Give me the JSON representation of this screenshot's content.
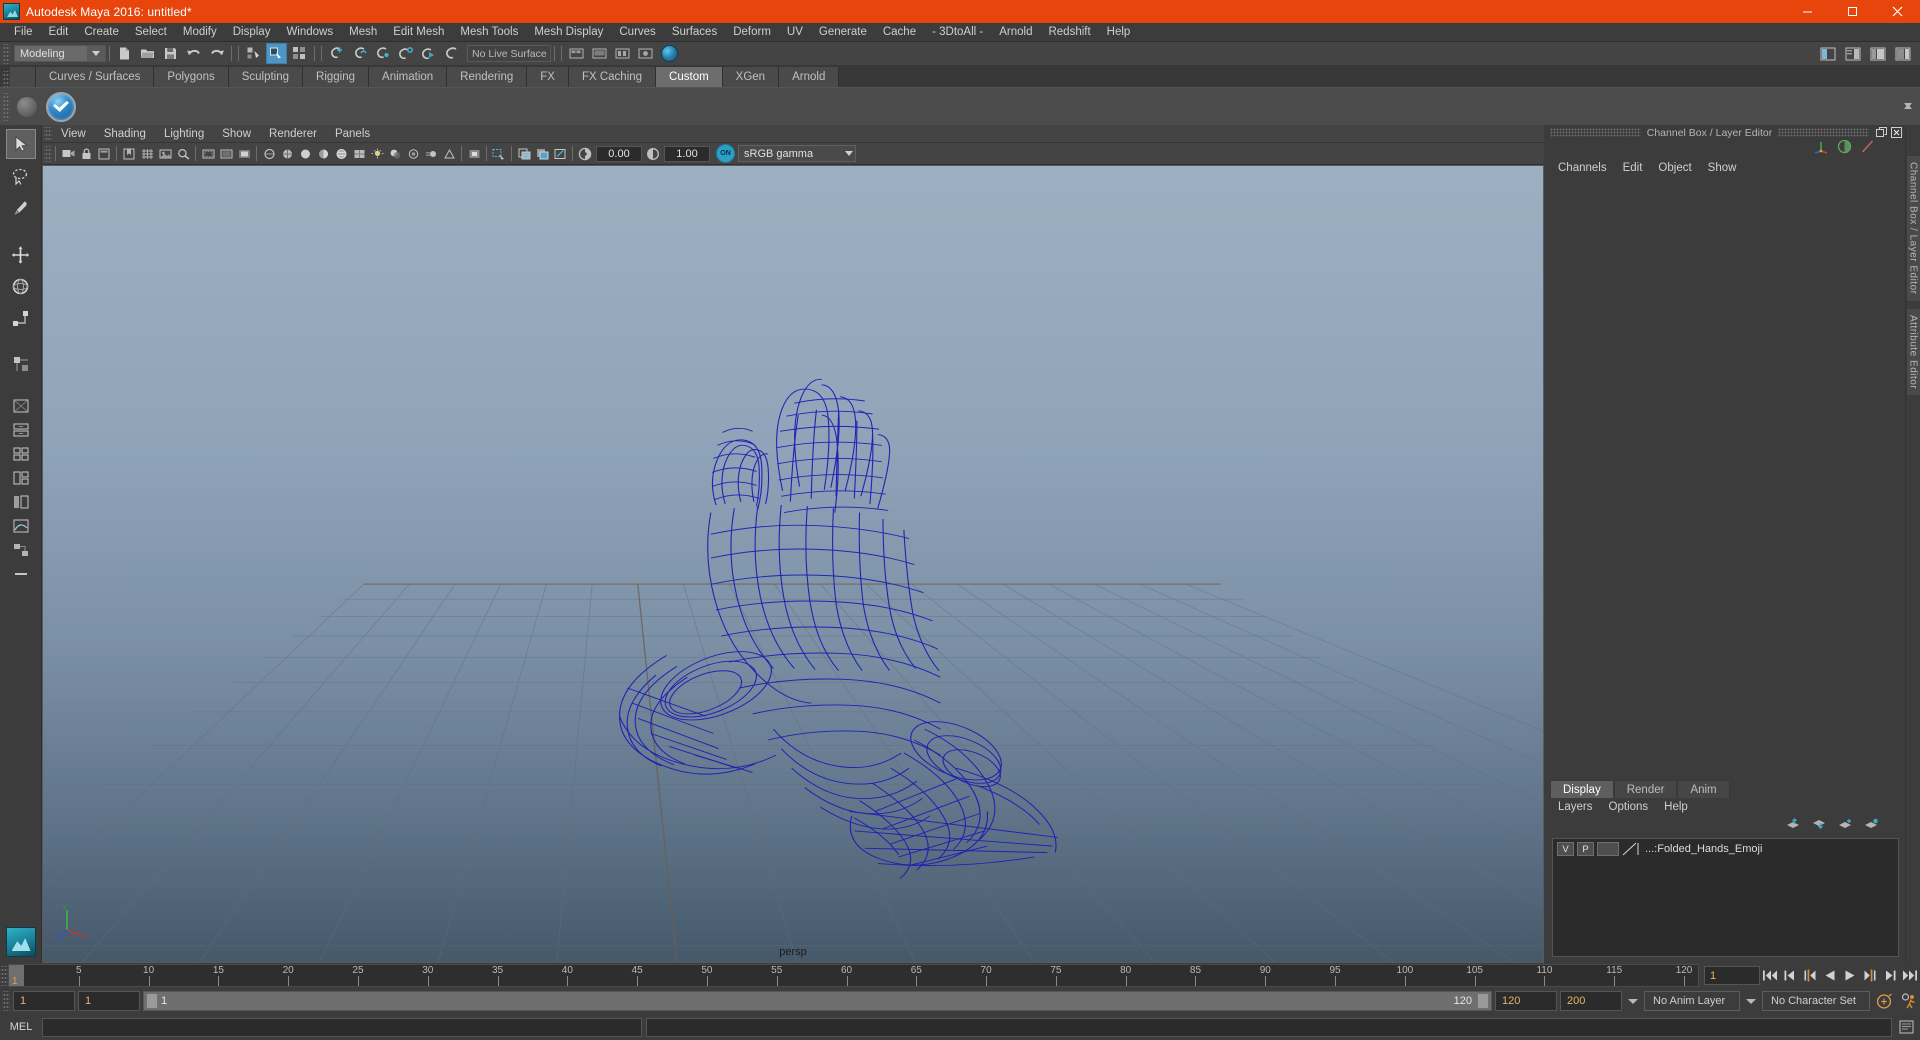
{
  "window": {
    "title": "Autodesk Maya 2016: untitled*",
    "logo_icon": "maya-logo-icon",
    "minimize_icon": "minimize-icon",
    "maximize_icon": "maximize-icon",
    "close_icon": "close-icon",
    "titlebar_color": "#e8450c"
  },
  "main_menu": [
    "File",
    "Edit",
    "Create",
    "Select",
    "Modify",
    "Display",
    "Windows",
    "Mesh",
    "Edit Mesh",
    "Mesh Tools",
    "Mesh Display",
    "Curves",
    "Surfaces",
    "Deform",
    "UV",
    "Generate",
    "Cache",
    "- 3DtoAll -",
    "Arnold",
    "Redshift",
    "Help"
  ],
  "status_bar": {
    "menu_set": "Modeling",
    "menu_set_arrow_icon": "chevron-down-icon",
    "new_scene_icon": "new-scene-icon",
    "open_scene_icon": "open-scene-icon",
    "save_scene_icon": "save-scene-icon",
    "undo_icon": "undo-icon",
    "redo_icon": "redo-icon",
    "select_hierarchy_icon": "select-by-hierarchy-icon",
    "select_object_icon": "select-by-object-type-icon",
    "select_component_icon": "select-by-component-type-icon",
    "snap_grid_icon": "snap-to-grid-icon",
    "snap_curve_icon": "snap-to-curve-icon",
    "snap_point_icon": "snap-to-point-icon",
    "snap_projected_icon": "snap-to-projected-center-icon",
    "snap_view_plane_icon": "snap-to-view-plane-icon",
    "make_live_icon": "make-live-icon",
    "live_surface_label": "No Live Surface",
    "render_sphere_icon": "render-globe-icon",
    "right_icons": [
      "show-hide-editor-icon",
      "attribute-editor-icon",
      "tool-settings-icon",
      "channel-box-icon"
    ]
  },
  "shelf": {
    "tabs": [
      "Curves / Surfaces",
      "Polygons",
      "Sculpting",
      "Rigging",
      "Animation",
      "Rendering",
      "FX",
      "FX Caching",
      "Custom",
      "XGen",
      "Arnold"
    ],
    "selected_tab": "Custom",
    "items": [
      {
        "icon": "blue-check-shelf-icon",
        "label": ""
      }
    ],
    "scroll_up_icon": "scroll-up-icon",
    "scroll_down_icon": "scroll-down-icon"
  },
  "toolbox": {
    "tools": [
      {
        "name": "select-tool",
        "icon": "arrow-cursor-icon",
        "selected": true
      },
      {
        "name": "lasso-tool",
        "icon": "lasso-select-icon",
        "selected": false
      },
      {
        "name": "paint-select-tool",
        "icon": "paint-brush-icon",
        "selected": false
      },
      {
        "name": "move-tool",
        "icon": "move-arrows-icon",
        "selected": false
      },
      {
        "name": "rotate-tool",
        "icon": "rotate-circle-icon",
        "selected": false
      },
      {
        "name": "scale-tool",
        "icon": "scale-box-icon",
        "selected": false
      },
      {
        "name": "last-tool",
        "icon": "last-used-tool-icon",
        "selected": false
      }
    ],
    "layout_buttons": [
      {
        "name": "layout-single",
        "icon": "single-pane-icon"
      },
      {
        "name": "layout-two-stacked",
        "icon": "two-pane-stacked-icon"
      },
      {
        "name": "layout-four",
        "icon": "four-pane-icon"
      },
      {
        "name": "layout-three-left",
        "icon": "three-pane-left-icon"
      },
      {
        "name": "layout-persp-outliner",
        "icon": "persp-outliner-icon"
      },
      {
        "name": "layout-persp-graph",
        "icon": "persp-graph-editor-icon"
      },
      {
        "name": "layout-hypershade",
        "icon": "hypershade-icon"
      },
      {
        "name": "layout-more",
        "icon": "more-layouts-icon"
      }
    ],
    "bottom_logo_icon": "maya-logo-icon"
  },
  "viewport": {
    "menus": [
      "View",
      "Shading",
      "Lighting",
      "Show",
      "Renderer",
      "Panels"
    ],
    "camera_label": "persp",
    "toolbar": {
      "exposure_value": "0.00",
      "gamma_value": "1.00",
      "color_management_toggle": "ON",
      "color_profile": "sRGB gamma",
      "color_profile_arrow_icon": "chevron-down-icon",
      "icons": [
        "select-camera-icon",
        "lock-camera-icon",
        "camera-attributes-icon",
        "bookmark-icon",
        "image-plane-icon",
        "two-d-pan-zoom-icon",
        "grid-toggle-icon",
        "film-gate-icon",
        "resolution-gate-icon",
        "gate-mask-icon",
        "xray-icon",
        "xray-joints-icon",
        "wireframe-shaded-icon",
        "smooth-shade-icon",
        "flat-shade-icon",
        "wireframe-on-shaded-icon",
        "texture-icon",
        "use-all-lights-icon",
        "shadows-icon",
        "screen-space-ao-icon",
        "motion-blur-icon",
        "multisample-icon",
        "depth-of-field-icon",
        "isolate-select-icon",
        "grid-display-icon",
        "xray-display-icon",
        "exposure-icon",
        "contrast-icon"
      ]
    },
    "axis_gizmo": {
      "x_label": "x",
      "y_label": "y",
      "z_label": "z"
    },
    "object": {
      "name": "Folded_Hands_Emoji",
      "display": "wireframe",
      "wire_color": "#1a1ab0"
    },
    "background_top": "#9aaec0",
    "background_bottom": "#4a5f72"
  },
  "channel_box": {
    "dock_title": "Channel Box / Layer Editor",
    "undock_icon": "undock-icon",
    "close_icon": "close-icon",
    "menus": [
      "Channels",
      "Edit",
      "Object",
      "Show"
    ],
    "header_icons": [
      "transform-axis-icon",
      "half-circle-icon",
      "slash-icon"
    ],
    "rows": []
  },
  "layer_editor": {
    "tabs": [
      "Display",
      "Render",
      "Anim"
    ],
    "selected_tab": "Display",
    "menus": [
      "Layers",
      "Options",
      "Help"
    ],
    "action_icons": [
      "move-layer-up-icon",
      "move-layer-down-icon",
      "new-layer-icon",
      "new-layer-from-selected-icon"
    ],
    "layers": [
      {
        "visibility": "V",
        "playback": "P",
        "shading": "",
        "color_swatch": "none",
        "name": "...:Folded_Hands_Emoji"
      }
    ]
  },
  "right_side_tabs": [
    "Channel Box / Layer Editor",
    "Attribute Editor"
  ],
  "time_slider": {
    "current_frame": "1",
    "ticks": [
      {
        "label": "5",
        "frame": 5
      },
      {
        "label": "10",
        "frame": 10
      },
      {
        "label": "15",
        "frame": 15
      },
      {
        "label": "20",
        "frame": 20
      },
      {
        "label": "25",
        "frame": 25
      },
      {
        "label": "30",
        "frame": 30
      },
      {
        "label": "35",
        "frame": 35
      },
      {
        "label": "40",
        "frame": 40
      },
      {
        "label": "45",
        "frame": 45
      },
      {
        "label": "50",
        "frame": 50
      },
      {
        "label": "55",
        "frame": 55
      },
      {
        "label": "60",
        "frame": 60
      },
      {
        "label": "65",
        "frame": 65
      },
      {
        "label": "70",
        "frame": 70
      },
      {
        "label": "75",
        "frame": 75
      },
      {
        "label": "80",
        "frame": 80
      },
      {
        "label": "85",
        "frame": 85
      },
      {
        "label": "90",
        "frame": 90
      },
      {
        "label": "95",
        "frame": 95
      },
      {
        "label": "100",
        "frame": 100
      },
      {
        "label": "105",
        "frame": 105
      },
      {
        "label": "110",
        "frame": 110
      },
      {
        "label": "115",
        "frame": 115
      },
      {
        "label": "120",
        "frame": 120
      }
    ],
    "range_end_label": "120",
    "frame_field": "1",
    "playback_buttons": [
      "go-to-start-icon",
      "step-back-frame-icon",
      "step-back-key-icon",
      "play-backwards-icon",
      "play-forwards-icon",
      "step-forward-key-icon",
      "step-forward-frame-icon",
      "go-to-end-icon"
    ]
  },
  "range_slider": {
    "anim_start": "1",
    "range_start": "1",
    "bar_start_label": "1",
    "bar_end_label": "120",
    "range_end": "120",
    "anim_end": "200",
    "anim_layer_arrow_icon": "chevron-down-icon",
    "anim_layer": "No Anim Layer",
    "character_set_arrow_icon": "chevron-down-icon",
    "character_set": "No Character Set",
    "auto_key_icon": "auto-keyframe-icon",
    "anim_prefs_icon": "animation-preferences-icon"
  },
  "command_line": {
    "label": "MEL",
    "input_value": "",
    "output_value": "",
    "script_editor_icon": "script-editor-icon"
  },
  "help_line": {
    "text": ""
  }
}
